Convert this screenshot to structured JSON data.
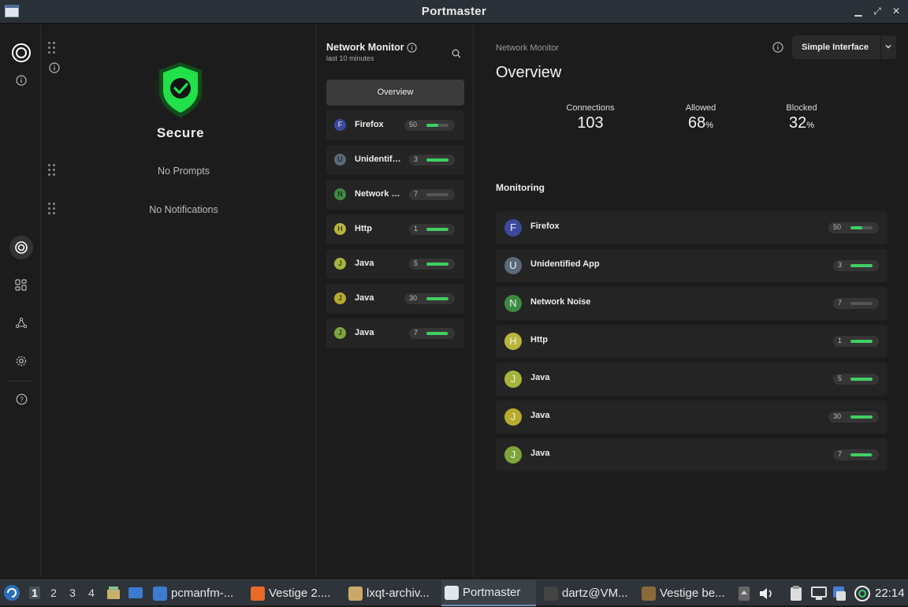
{
  "window": {
    "title": "Portmaster"
  },
  "dashboard": {
    "status": "Secure",
    "prompts": "No Prompts",
    "notifications": "No Notifications"
  },
  "network_monitor": {
    "title": "Network Monitor",
    "subtitle": "last 10 minutes",
    "overview_button": "Overview",
    "items": [
      {
        "initial": "F",
        "name": "Firefox",
        "count": "50",
        "allowed_fraction": 0.55,
        "color": "#3b4a9c"
      },
      {
        "initial": "U",
        "name": "Unidentified App",
        "count": "3",
        "allowed_fraction": 1.0,
        "color": "#5a6a7a"
      },
      {
        "initial": "N",
        "name": "Network Noise",
        "count": "7",
        "allowed_fraction": 0.0,
        "color": "#3d8a43"
      },
      {
        "initial": "H",
        "name": "Http",
        "count": "1",
        "allowed_fraction": 1.0,
        "color": "#b7b63a"
      },
      {
        "initial": "J",
        "name": "Java",
        "count": "5",
        "allowed_fraction": 1.0,
        "color": "#a6b43a"
      },
      {
        "initial": "J",
        "name": "Java",
        "count": "30",
        "allowed_fraction": 1.0,
        "color": "#b7aa2d"
      },
      {
        "initial": "J",
        "name": "Java",
        "count": "7",
        "allowed_fraction": 0.95,
        "color": "#7ea53c"
      }
    ]
  },
  "overview": {
    "breadcrumb": "Network Monitor",
    "title": "Overview",
    "interface_button": "Simple Interface",
    "stats": [
      {
        "label": "Connections",
        "value": "103",
        "unit": ""
      },
      {
        "label": "Allowed",
        "value": "68",
        "unit": "%"
      },
      {
        "label": "Blocked",
        "value": "32",
        "unit": "%"
      }
    ],
    "monitoring_title": "Monitoring"
  },
  "taskbar": {
    "workspaces": [
      "1",
      "2",
      "3",
      "4"
    ],
    "active_workspace": "1",
    "windows": [
      {
        "label": "pcmanfm-...",
        "active": false
      },
      {
        "label": "Vestige 2....",
        "active": false
      },
      {
        "label": "lxqt-archiv...",
        "active": false
      },
      {
        "label": "Portmaster",
        "active": true
      },
      {
        "label": "dartz@VM...",
        "active": false
      },
      {
        "label": "Vestige be...",
        "active": false
      }
    ],
    "clock": "22:14"
  },
  "colors": {
    "accent_green": "#3ecf62",
    "shield_green": "#22e04a",
    "background": "#1c1c1c",
    "row": "#242424"
  }
}
